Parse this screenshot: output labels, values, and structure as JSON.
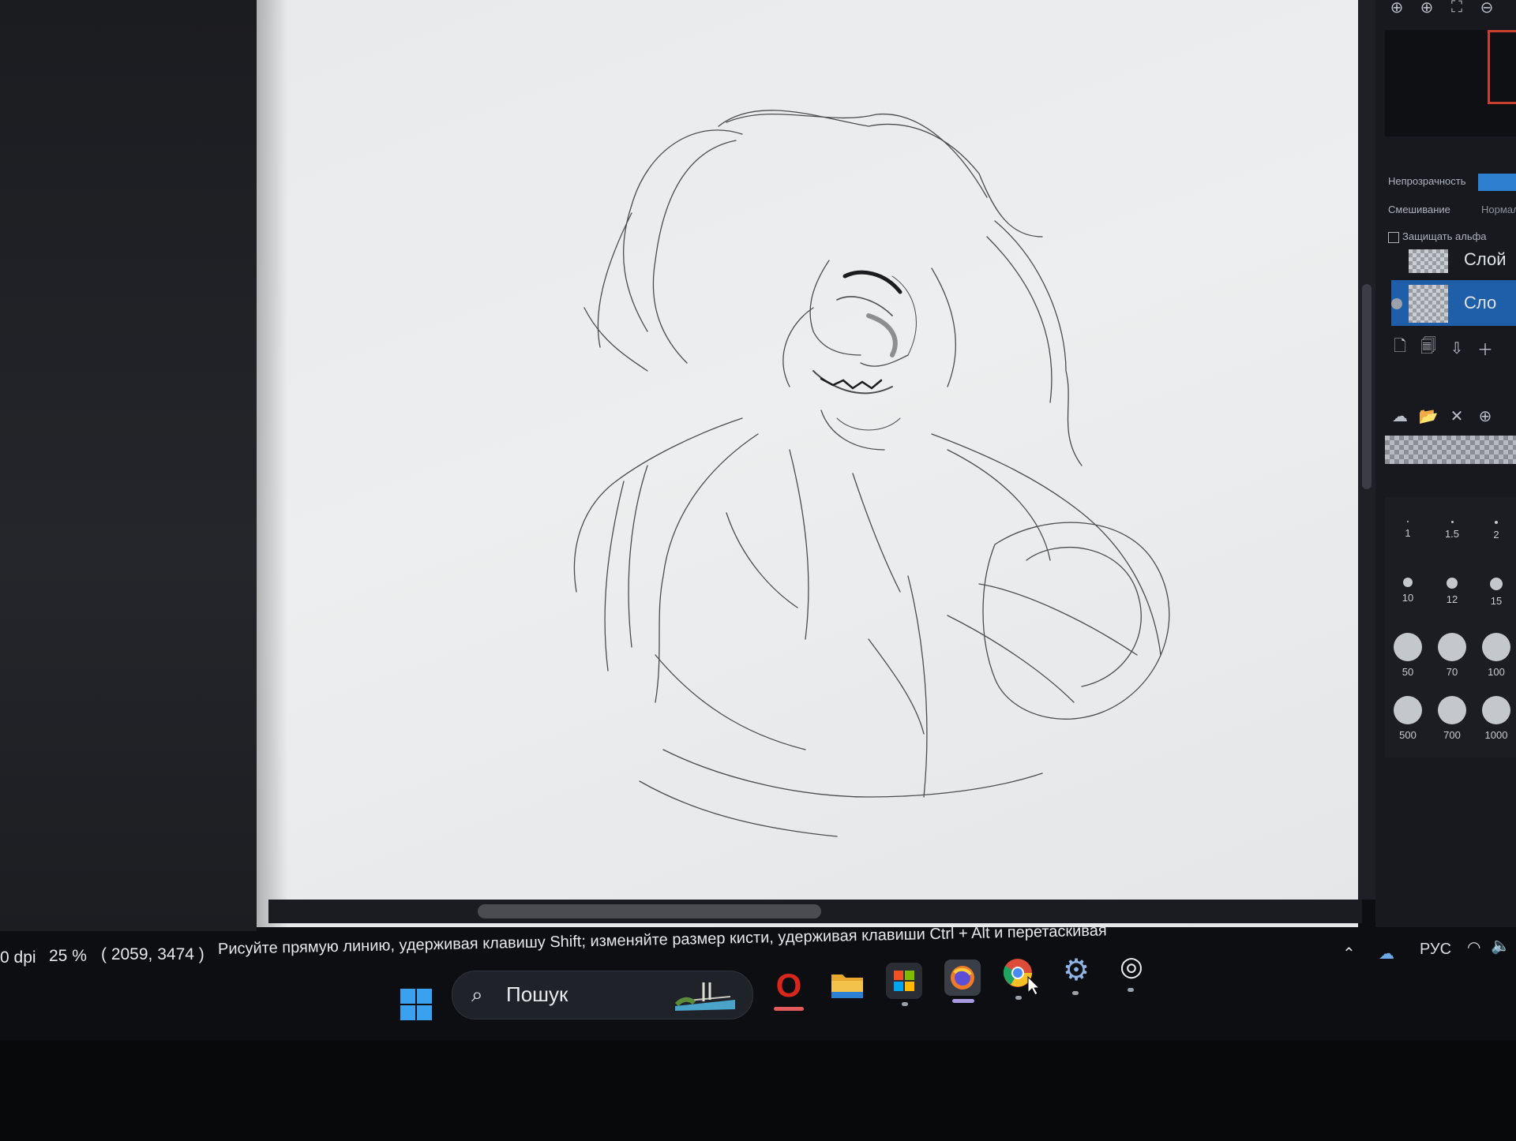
{
  "panel": {
    "opacity_label": "Непрозрачность",
    "blend_label": "Смешивание",
    "blend_value": "Нормал",
    "protect_alpha_label": "Защищать альфа",
    "layers": [
      {
        "name": "Слой",
        "active": false
      },
      {
        "name": "Сло",
        "active": true
      }
    ],
    "brush_sizes": [
      "1",
      "1.5",
      "2",
      "10",
      "12",
      "15",
      "50",
      "70",
      "100",
      "500",
      "700",
      "1000"
    ]
  },
  "status": {
    "dpi": "0 dpi",
    "zoom": "25 %",
    "coords": "( 2059, 3474 )",
    "hint_line1": "Рисуйте прямую линию, удерживая клавишу Shift; изменяйте размер кисти, удерживая клавиши Ctrl + Alt и перетаскивая"
  },
  "taskbar": {
    "search_placeholder": "Пошук",
    "apps": [
      "start-icon",
      "opera-icon",
      "file-explorer-icon",
      "store-icon",
      "firefox-icon",
      "chrome-icon",
      "settings-icon",
      "app-icon"
    ]
  },
  "tray": {
    "language": "РУС"
  },
  "colors": {
    "accent": "#2f7fd1",
    "layer_active": "#1f5ea8",
    "opera_red": "#d8261c"
  }
}
